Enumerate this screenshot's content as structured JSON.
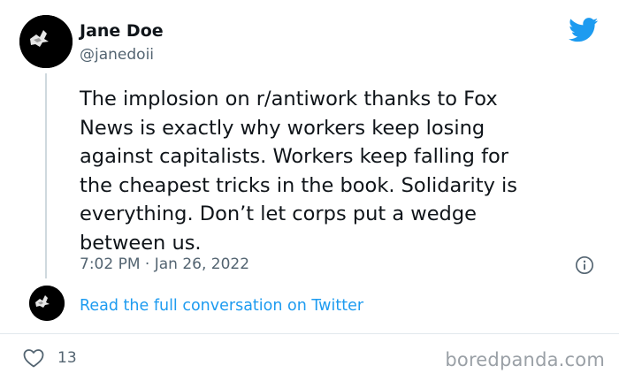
{
  "user": {
    "name": "Jane Doe",
    "handle": "@janedoii"
  },
  "tweet": {
    "text": "The implosion on r/antiwork thanks to Fox\nNews is exactly why workers keep losing\nagainst capitalists. Workers keep falling for\nthe cheapest tricks in the book. Solidarity is\neverything. Don’t let corps put a wedge\nbetween us.",
    "timestamp": "7:02 PM · Jan 26, 2022"
  },
  "conversation_link": "Read the full conversation on Twitter",
  "likes": {
    "count": "13"
  },
  "watermark": "boredpanda.com",
  "icons": {
    "brand": "twitter-bird-icon",
    "info": "info-icon",
    "like": "heart-icon"
  },
  "colors": {
    "twitter_blue": "#1d9bf0",
    "text_primary": "#0f1419",
    "text_secondary": "#536471",
    "thread_line": "#cfd9de"
  }
}
